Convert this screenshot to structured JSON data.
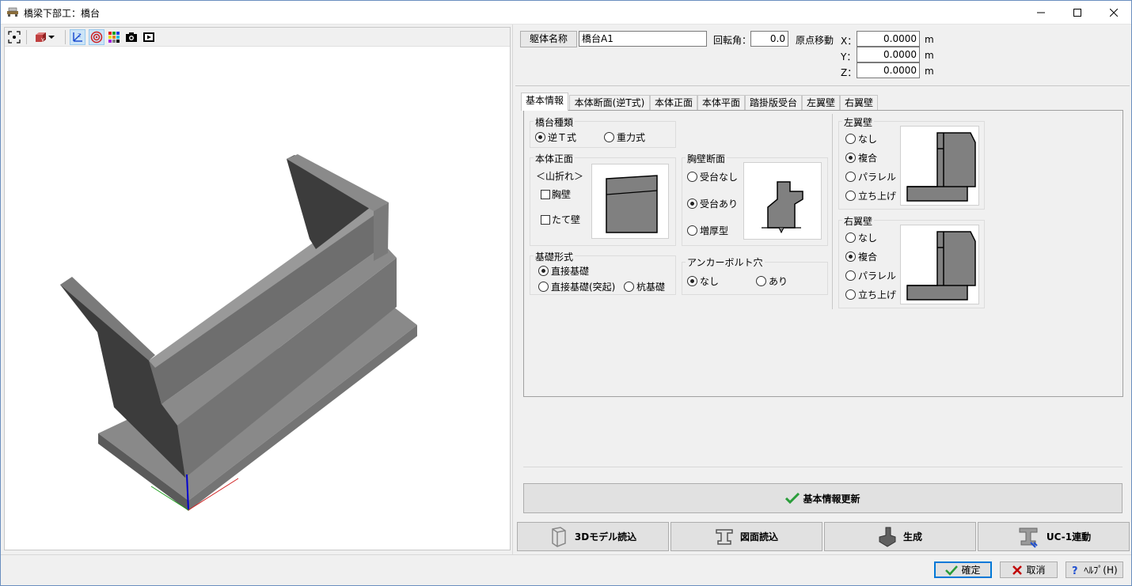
{
  "window": {
    "title": "橋梁下部工：橋台"
  },
  "header": {
    "body_name_label": "躯体名称",
    "body_name_value": "橋台A1",
    "rotation_label": "回転角：",
    "rotation_value": "0.0",
    "origin_label": "原点移動",
    "x_label": "X：",
    "y_label": "Y：",
    "z_label": "Z：",
    "x_value": "0.0000",
    "y_value": "0.0000",
    "z_value": "0.0000",
    "unit": "m"
  },
  "tabs": [
    {
      "label": "基本情報",
      "selected": true
    },
    {
      "label": "本体断面(逆T式)"
    },
    {
      "label": "本体正面"
    },
    {
      "label": "本体平面"
    },
    {
      "label": "踏掛版受台"
    },
    {
      "label": "左翼壁"
    },
    {
      "label": "右翼壁"
    }
  ],
  "abutment_type": {
    "label": "橋台種類",
    "options": [
      {
        "label": "逆Ｔ式",
        "checked": true
      },
      {
        "label": "重力式",
        "checked": false
      }
    ]
  },
  "body_front": {
    "label": "本体正面",
    "note": "＜山折れ＞",
    "checks": [
      {
        "label": "胸壁",
        "checked": false
      },
      {
        "label": "たて壁",
        "checked": false
      }
    ]
  },
  "parapet_section": {
    "label": "胸壁断面",
    "options": [
      {
        "label": "受台なし",
        "checked": false
      },
      {
        "label": "受台あり",
        "checked": true
      },
      {
        "label": "増厚型",
        "checked": false
      }
    ]
  },
  "foundation": {
    "label": "基礎形式",
    "options": [
      {
        "label": "直接基礎",
        "checked": true
      },
      {
        "label": "直接基礎(突起)",
        "checked": false
      },
      {
        "label": "杭基礎",
        "checked": false
      }
    ]
  },
  "anchor_bolt": {
    "label": "アンカーボルト穴",
    "options": [
      {
        "label": "なし",
        "checked": true
      },
      {
        "label": "あり",
        "checked": false
      }
    ]
  },
  "left_wing": {
    "label": "左翼壁",
    "options": [
      {
        "label": "なし",
        "checked": false
      },
      {
        "label": "複合",
        "checked": true
      },
      {
        "label": "パラレル",
        "checked": false
      },
      {
        "label": "立ち上げ",
        "checked": false
      }
    ]
  },
  "right_wing": {
    "label": "右翼壁",
    "options": [
      {
        "label": "なし",
        "checked": false
      },
      {
        "label": "複合",
        "checked": true
      },
      {
        "label": "パラレル",
        "checked": false
      },
      {
        "label": "立ち上げ",
        "checked": false
      }
    ]
  },
  "update_button": "基本情報更新",
  "action_buttons": {
    "load3d": "3Dモデル読込",
    "load_drawing": "図面読込",
    "generate": "生成",
    "uc1": "UC-1連動"
  },
  "dialog": {
    "ok": "確定",
    "cancel": "取消",
    "help": "ﾍﾙﾌﾟ(H)"
  },
  "colors": {
    "accent": "#0078d7",
    "model_light": "#808080",
    "model_dark": "#3c3c3c",
    "check_green": "#2a9d3a",
    "cancel_red": "#c00000"
  }
}
